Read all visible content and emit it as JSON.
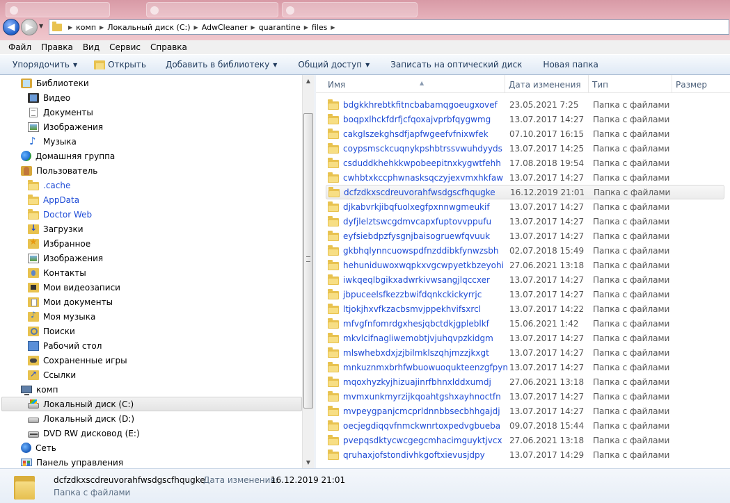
{
  "address": {
    "crumbs": [
      "комп",
      "Локальный диск (C:)",
      "AdwCleaner",
      "quarantine",
      "files"
    ]
  },
  "menu": [
    "Файл",
    "Правка",
    "Вид",
    "Сервис",
    "Справка"
  ],
  "commands": {
    "organize": "Упорядочить",
    "open": "Открыть",
    "add_to_library": "Добавить в библиотеку",
    "share": "Общий доступ",
    "burn": "Записать на оптический диск",
    "new_folder": "Новая папка"
  },
  "tree": [
    {
      "label": "Библиотеки",
      "icon": "library-icon",
      "indent": 0
    },
    {
      "label": "Видео",
      "icon": "video-icon",
      "indent": 1
    },
    {
      "label": "Документы",
      "icon": "documents-icon",
      "indent": 1
    },
    {
      "label": "Изображения",
      "icon": "pictures-icon",
      "indent": 1
    },
    {
      "label": "Музыка",
      "icon": "music-icon",
      "indent": 1
    },
    {
      "label": "Домашняя группа",
      "icon": "homegroup-icon",
      "indent": 0
    },
    {
      "label": "Пользователь",
      "icon": "user-folder-icon",
      "indent": 0
    },
    {
      "label": ".cache",
      "icon": "folder-icon",
      "indent": 1,
      "link": true
    },
    {
      "label": "AppData",
      "icon": "folder-icon",
      "indent": 1,
      "link": true
    },
    {
      "label": "Doctor Web",
      "icon": "folder-icon",
      "indent": 1,
      "link": true
    },
    {
      "label": "Загрузки",
      "icon": "downloads-icon",
      "indent": 1
    },
    {
      "label": "Избранное",
      "icon": "favorites-icon",
      "indent": 1
    },
    {
      "label": "Изображения",
      "icon": "pictures-folder-icon",
      "indent": 1
    },
    {
      "label": "Контакты",
      "icon": "contacts-icon",
      "indent": 1
    },
    {
      "label": "Мои видеозаписи",
      "icon": "my-videos-icon",
      "indent": 1
    },
    {
      "label": "Мои документы",
      "icon": "my-documents-icon",
      "indent": 1
    },
    {
      "label": "Моя музыка",
      "icon": "my-music-icon",
      "indent": 1
    },
    {
      "label": "Поиски",
      "icon": "searches-icon",
      "indent": 1
    },
    {
      "label": "Рабочий стол",
      "icon": "desktop-icon",
      "indent": 1
    },
    {
      "label": "Сохраненные игры",
      "icon": "saved-games-icon",
      "indent": 1
    },
    {
      "label": "Ссылки",
      "icon": "links-icon",
      "indent": 1
    },
    {
      "label": "комп",
      "icon": "computer-icon",
      "indent": 0
    },
    {
      "label": "Локальный диск (C:)",
      "icon": "system-drive-icon",
      "indent": 1,
      "selected": true
    },
    {
      "label": "Локальный диск (D:)",
      "icon": "drive-icon",
      "indent": 1
    },
    {
      "label": "DVD RW дисковод (E:)",
      "icon": "dvd-drive-icon",
      "indent": 1
    },
    {
      "label": "Сеть",
      "icon": "network-icon",
      "indent": 0
    },
    {
      "label": "Панель управления",
      "icon": "control-panel-icon",
      "indent": 0
    }
  ],
  "columns": {
    "name": "Имя",
    "date": "Дата изменения",
    "type": "Тип",
    "size": "Размер"
  },
  "files": [
    {
      "name": "bdgkkhrebtkfitncbabamqgoeugxovef",
      "date": "23.05.2021 7:25",
      "type": "Папка с файлами"
    },
    {
      "name": "boqpxlhckfdrfjcfqoxajvprbfqygwmg",
      "date": "13.07.2017 14:27",
      "type": "Папка с файлами"
    },
    {
      "name": "cakglszekghsdfjapfwgeefvfnixwfek",
      "date": "07.10.2017 16:15",
      "type": "Папка с файлами"
    },
    {
      "name": "coypsmsckcuqnykpshbtrssvwuhdyyds",
      "date": "13.07.2017 14:25",
      "type": "Папка с файлами"
    },
    {
      "name": "csduddkhehkkwpobeepitnxkygwtfehh",
      "date": "17.08.2018 19:54",
      "type": "Папка с файлами"
    },
    {
      "name": "cwhbtxkccphwnasksqczyjexvmxhkfaw",
      "date": "13.07.2017 14:27",
      "type": "Папка с файлами"
    },
    {
      "name": "dcfzdkxscdreuvorahfwsdgscfhqugke",
      "date": "16.12.2019 21:01",
      "type": "Папка с файлами",
      "hot": true
    },
    {
      "name": "djkabvrkjibqfuolxegfpxnnwgmeukif",
      "date": "13.07.2017 14:27",
      "type": "Папка с файлами"
    },
    {
      "name": "dyfjlelztswcgdmvcapxfuptovvppufu",
      "date": "13.07.2017 14:27",
      "type": "Папка с файлами"
    },
    {
      "name": "eyfsiebdpzfysgnjbaisogruewfqvuuk",
      "date": "13.07.2017 14:27",
      "type": "Папка с файлами"
    },
    {
      "name": "gkbhqlynncuowspdfnzddibkfynwzsbh",
      "date": "02.07.2018 15:49",
      "type": "Папка с файлами"
    },
    {
      "name": "hehuniduwoxwqpkxvgcwpyetkbzeyohi",
      "date": "27.06.2021 13:18",
      "type": "Папка с файлами"
    },
    {
      "name": "iwkqeqlbgikxadwrkivwsangjlqccxer",
      "date": "13.07.2017 14:27",
      "type": "Папка с файлами"
    },
    {
      "name": "jbpuceelsfkezzbwifdqnkckickyrrjc",
      "date": "13.07.2017 14:27",
      "type": "Папка с файлами"
    },
    {
      "name": "ltjokjhxvfkzacbsmvjppekhvifsxrcl",
      "date": "13.07.2017 14:22",
      "type": "Папка с файлами"
    },
    {
      "name": "mfvgfnfomrdgxhesjqbctdkjgpleblkf",
      "date": "15.06.2021 1:42",
      "type": "Папка с файлами"
    },
    {
      "name": "mkvlcifnagliwemobtjvjuhqvpzkidgm",
      "date": "13.07.2017 14:27",
      "type": "Папка с файлами"
    },
    {
      "name": "mlswhebxdxjzjbilmklszqhjmzzjkxgt",
      "date": "13.07.2017 14:27",
      "type": "Папка с файлами"
    },
    {
      "name": "mnkuznmxbrhfwbuowuoqukteenzgfpyn",
      "date": "13.07.2017 14:27",
      "type": "Папка с файлами"
    },
    {
      "name": "mqoxhyzkyjhizuajinrfbhnxlddxumdj",
      "date": "27.06.2021 13:18",
      "type": "Папка с файлами"
    },
    {
      "name": "mvmxunkmyrzijkqoahtgshxayhnoctfn",
      "date": "13.07.2017 14:27",
      "type": "Папка с файлами"
    },
    {
      "name": "mvpeygpanjcmcprldnnbbsecbhhgajdj",
      "date": "13.07.2017 14:27",
      "type": "Папка с файлами"
    },
    {
      "name": "oecjegdiqqvfnmckwnrtoxpedvgbueba",
      "date": "09.07.2018 15:44",
      "type": "Папка с файлами"
    },
    {
      "name": "pvepqsdktycwcgegcmhacimguyktjvcx",
      "date": "27.06.2021 13:18",
      "type": "Папка с файлами"
    },
    {
      "name": "qruhaxjofstondivhkgoftxievusjdpy",
      "date": "13.07.2017 14:29",
      "type": "Папка с файлами"
    }
  ],
  "details": {
    "name": "dcfzdkxscdreuvorahfwsdgscfhqugke",
    "date_label": "Дата изменения:",
    "date": "16.12.2019 21:01",
    "type": "Папка с файлами"
  }
}
